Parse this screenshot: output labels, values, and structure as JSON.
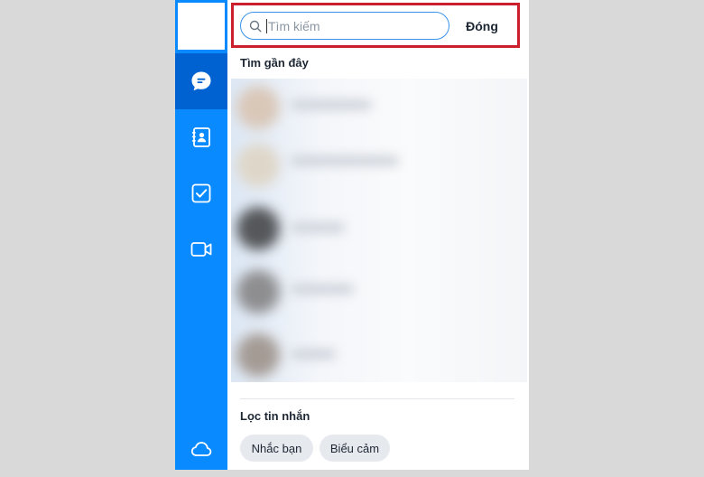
{
  "search": {
    "placeholder": "Tìm kiếm",
    "close_label": "Đóng"
  },
  "recent": {
    "title": "Tìm gần đây"
  },
  "filter": {
    "title": "Lọc tin nhắn",
    "chips": [
      {
        "label": "Nhắc bạn"
      },
      {
        "label": "Biểu cảm"
      }
    ]
  },
  "sidebar": {
    "items": [
      {
        "icon": "chat-bubble-icon",
        "active": true
      },
      {
        "icon": "contacts-icon",
        "active": false
      },
      {
        "icon": "todo-check-icon",
        "active": false
      },
      {
        "icon": "video-call-icon",
        "active": false
      },
      {
        "icon": "cloud-icon",
        "active": false
      }
    ]
  },
  "colors": {
    "sidebar_bg": "#0a8aff",
    "sidebar_active": "#0062d1",
    "highlight_border": "#cc1f2e",
    "search_border": "#3a93ea",
    "chip_bg": "#e6e9ee"
  }
}
